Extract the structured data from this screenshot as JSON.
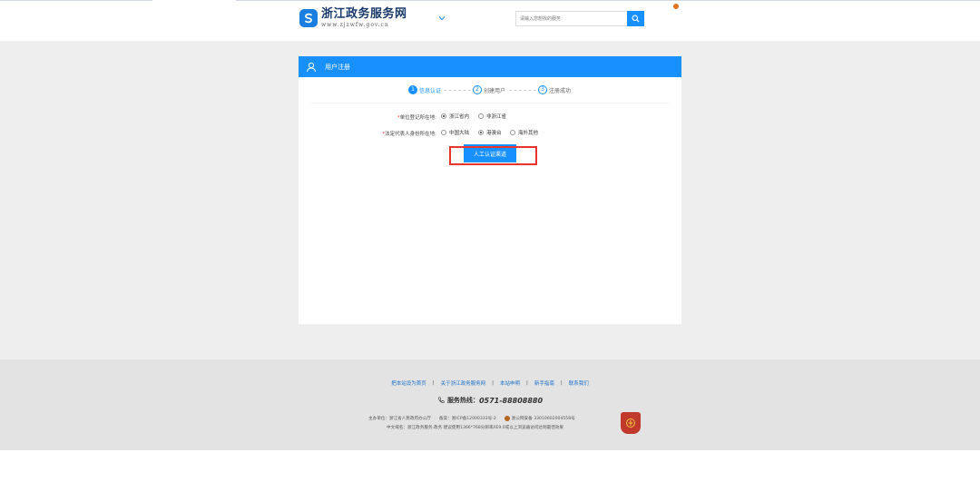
{
  "header": {
    "logo_title": "浙江政务服务网",
    "logo_url": "www.zjzwfw.gov.cn",
    "search_placeholder": "请输入您想找的服务"
  },
  "card": {
    "title": "用户注册",
    "steps": [
      {
        "num": "1",
        "label": "信息认证",
        "active": true
      },
      {
        "num": "2",
        "label": "创建用户",
        "active": false
      },
      {
        "num": "3",
        "label": "注册成功",
        "active": false
      }
    ],
    "form": {
      "row1": {
        "label": "单位登记所在地:",
        "options": [
          {
            "label": "浙江省内",
            "selected": true
          },
          {
            "label": "非浙江省",
            "selected": false
          }
        ]
      },
      "row2": {
        "label": "法定代表人身份所在地:",
        "options": [
          {
            "label": "中国大陆",
            "selected": false
          },
          {
            "label": "港澳台",
            "selected": true
          },
          {
            "label": "海外其他",
            "selected": false
          }
        ]
      }
    },
    "manual_button": "人工认证渠道"
  },
  "footer": {
    "links": [
      "把本站设为首页",
      "关于浙江政务服务网",
      "本站申明",
      "新手指南",
      "联系我们"
    ],
    "hotline_label": "服务热线：",
    "hotline_number": "0571-88808880",
    "host": "主办单位：浙江省人民政府办公厅",
    "icp": "备案：浙ICP备12000333号-2",
    "police": "浙公网安备 33010602004558号",
    "line2": "中文域名：浙江政务服务.政务  建议使用1366*768分辨率/IE9.0或以上浏览器访问达到最佳效果"
  },
  "colors": {
    "accent": "#1890ff",
    "highlight": "#e8342c",
    "required": "#e33333"
  }
}
